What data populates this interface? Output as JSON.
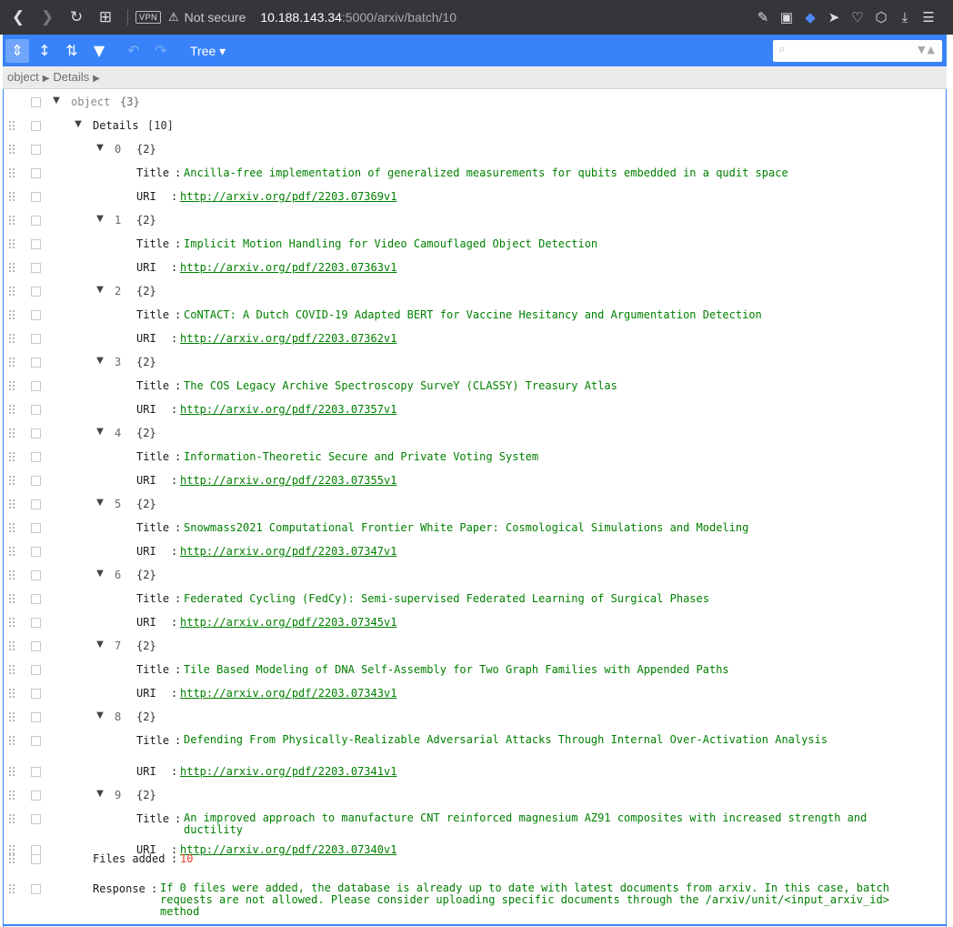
{
  "browser": {
    "vpn_label": "VPN",
    "security_label": "Not secure",
    "url_host": "10.188.143.34",
    "url_path": ":5000/arxiv/batch/10"
  },
  "editor": {
    "mode_label": "Tree ▾",
    "search_placeholder": "",
    "breadcrumb": [
      "object",
      "Details"
    ],
    "root": {
      "label": "object",
      "count": "{3}"
    },
    "details": {
      "label": "Details",
      "count": "[10]"
    },
    "item_count": "{2}",
    "title_key": "Title",
    "uri_key": "URI",
    "colon": ":",
    "items": [
      {
        "index": "0",
        "title": "Ancilla-free implementation of generalized measurements for qubits embedded in a qudit space",
        "uri": "http://arxiv.org/pdf/2203.07369v1"
      },
      {
        "index": "1",
        "title": "Implicit Motion Handling for Video Camouflaged Object Detection",
        "uri": "http://arxiv.org/pdf/2203.07363v1"
      },
      {
        "index": "2",
        "title": "CoNTACT: A Dutch COVID-19 Adapted BERT for Vaccine Hesitancy and Argumentation Detection",
        "uri": "http://arxiv.org/pdf/2203.07362v1"
      },
      {
        "index": "3",
        "title": "The COS Legacy Archive Spectroscopy SurveY (CLASSY) Treasury Atlas",
        "uri": "http://arxiv.org/pdf/2203.07357v1"
      },
      {
        "index": "4",
        "title": "Information-Theoretic Secure and Private Voting System",
        "uri": "http://arxiv.org/pdf/2203.07355v1"
      },
      {
        "index": "5",
        "title": "Snowmass2021 Computational Frontier White Paper: Cosmological Simulations and Modeling",
        "uri": "http://arxiv.org/pdf/2203.07347v1"
      },
      {
        "index": "6",
        "title": "Federated Cycling (FedCy): Semi-supervised Federated Learning of Surgical Phases",
        "uri": "http://arxiv.org/pdf/2203.07345v1"
      },
      {
        "index": "7",
        "title": "Tile Based Modeling of DNA Self-Assembly for Two Graph Families with Appended Paths",
        "uri": "http://arxiv.org/pdf/2203.07343v1"
      },
      {
        "index": "8",
        "title": "Defending From Physically-Realizable Adversarial Attacks Through Internal Over-Activation Analysis",
        "uri": "http://arxiv.org/pdf/2203.07341v1"
      },
      {
        "index": "9",
        "title": "An improved approach to manufacture CNT reinforced magnesium AZ91 composites with increased strength and ductility",
        "uri": "http://arxiv.org/pdf/2203.07340v1"
      }
    ],
    "files_added": {
      "key": "Files added",
      "value": "10"
    },
    "response": {
      "key": "Response",
      "value": "If 0 files were added, the database is already up to date with latest documents from arxiv. In this case, batch requests are not allowed. Please consider uploading specific documents through the /arxiv/unit/<input_arxiv_id> method"
    }
  }
}
